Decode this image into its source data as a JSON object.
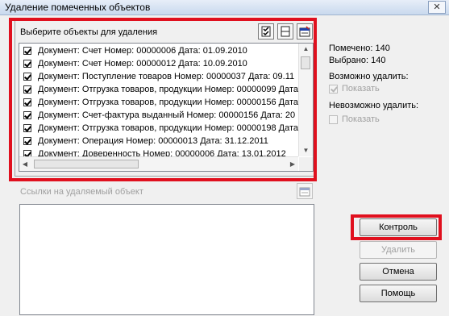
{
  "window": {
    "title": "Удаление помеченных объектов",
    "close_glyph": "✕"
  },
  "panel": {
    "label": "Выберите объекты для удаления",
    "toolbar_icons": [
      "check-all-icon",
      "uncheck-all-icon",
      "properties-icon"
    ],
    "items": [
      {
        "text": "Документ: Счет  Номер: 00000006  Дата: 01.09.2010",
        "checked": true
      },
      {
        "text": "Документ: Счет  Номер: 00000012  Дата: 10.09.2010",
        "checked": true
      },
      {
        "text": "Документ: Поступление товаров  Номер: 00000037  Дата: 09.11",
        "checked": true
      },
      {
        "text": "Документ: Отгрузка товаров, продукции  Номер: 00000099  Дата",
        "checked": true
      },
      {
        "text": "Документ: Отгрузка товаров, продукции  Номер: 00000156  Дата",
        "checked": true
      },
      {
        "text": "Документ: Счет-фактура выданный  Номер: 00000156  Дата: 20",
        "checked": true
      },
      {
        "text": "Документ: Отгрузка товаров, продукции  Номер: 00000198  Дата",
        "checked": true
      },
      {
        "text": "Документ: Операция  Номер: 00000013  Дата: 31.12.2011",
        "checked": true
      },
      {
        "text": "Документ: Доверенность  Номер: 00000006  Дата: 13.01.2012",
        "checked": true
      }
    ]
  },
  "stats": {
    "marked": "Помечено: 140",
    "selected": "Выбрано: 140"
  },
  "can_delete": {
    "label": "Возможно удалить:",
    "show": "Показать",
    "checked": true
  },
  "cannot_delete": {
    "label": "Невозможно удалить:",
    "show": "Показать",
    "checked": false
  },
  "links": {
    "label": "Ссылки на удаляемый объект"
  },
  "buttons": {
    "control": "Контроль",
    "delete": "Удалить",
    "cancel": "Отмена",
    "help": "Помощь"
  }
}
